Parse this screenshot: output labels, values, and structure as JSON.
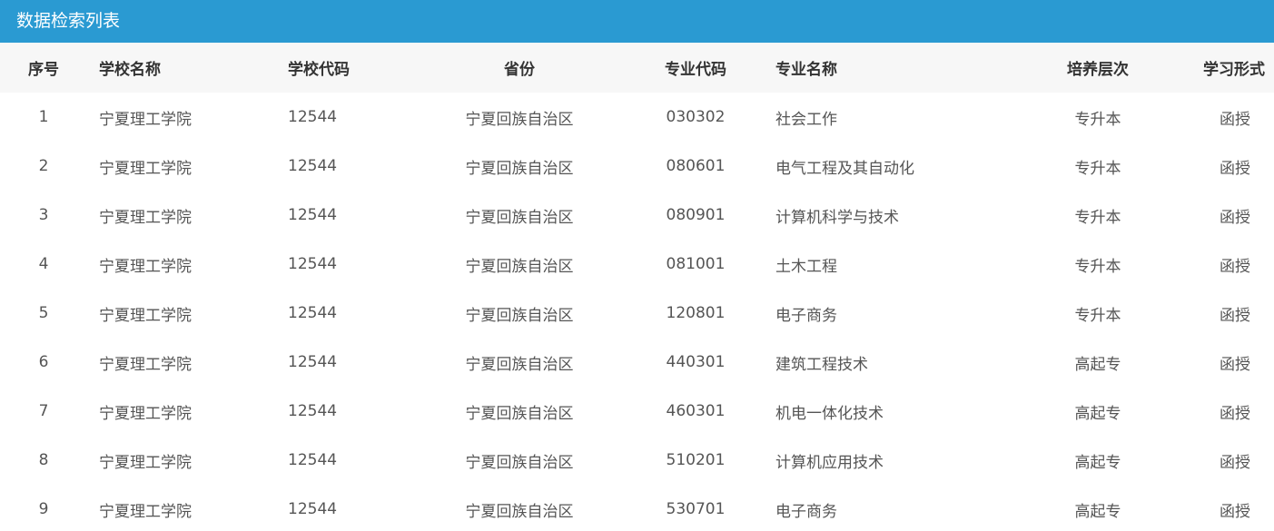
{
  "panel": {
    "title": "数据检索列表"
  },
  "table": {
    "headers": {
      "no": "序号",
      "school": "学校名称",
      "school_code": "学校代码",
      "province": "省份",
      "major_code": "专业代码",
      "major_name": "专业名称",
      "level": "培养层次",
      "study_form": "学习形式"
    },
    "rows": [
      {
        "no": "1",
        "school": "宁夏理工学院",
        "school_code": "12544",
        "province": "宁夏回族自治区",
        "major_code": "030302",
        "major_name": "社会工作",
        "level": "专升本",
        "study_form": "函授"
      },
      {
        "no": "2",
        "school": "宁夏理工学院",
        "school_code": "12544",
        "province": "宁夏回族自治区",
        "major_code": "080601",
        "major_name": "电气工程及其自动化",
        "level": "专升本",
        "study_form": "函授"
      },
      {
        "no": "3",
        "school": "宁夏理工学院",
        "school_code": "12544",
        "province": "宁夏回族自治区",
        "major_code": "080901",
        "major_name": "计算机科学与技术",
        "level": "专升本",
        "study_form": "函授"
      },
      {
        "no": "4",
        "school": "宁夏理工学院",
        "school_code": "12544",
        "province": "宁夏回族自治区",
        "major_code": "081001",
        "major_name": "土木工程",
        "level": "专升本",
        "study_form": "函授"
      },
      {
        "no": "5",
        "school": "宁夏理工学院",
        "school_code": "12544",
        "province": "宁夏回族自治区",
        "major_code": "120801",
        "major_name": "电子商务",
        "level": "专升本",
        "study_form": "函授"
      },
      {
        "no": "6",
        "school": "宁夏理工学院",
        "school_code": "12544",
        "province": "宁夏回族自治区",
        "major_code": "440301",
        "major_name": "建筑工程技术",
        "level": "高起专",
        "study_form": "函授"
      },
      {
        "no": "7",
        "school": "宁夏理工学院",
        "school_code": "12544",
        "province": "宁夏回族自治区",
        "major_code": "460301",
        "major_name": "机电一体化技术",
        "level": "高起专",
        "study_form": "函授"
      },
      {
        "no": "8",
        "school": "宁夏理工学院",
        "school_code": "12544",
        "province": "宁夏回族自治区",
        "major_code": "510201",
        "major_name": "计算机应用技术",
        "level": "高起专",
        "study_form": "函授"
      },
      {
        "no": "9",
        "school": "宁夏理工学院",
        "school_code": "12544",
        "province": "宁夏回族自治区",
        "major_code": "530701",
        "major_name": "电子商务",
        "level": "高起专",
        "study_form": "函授"
      }
    ]
  }
}
